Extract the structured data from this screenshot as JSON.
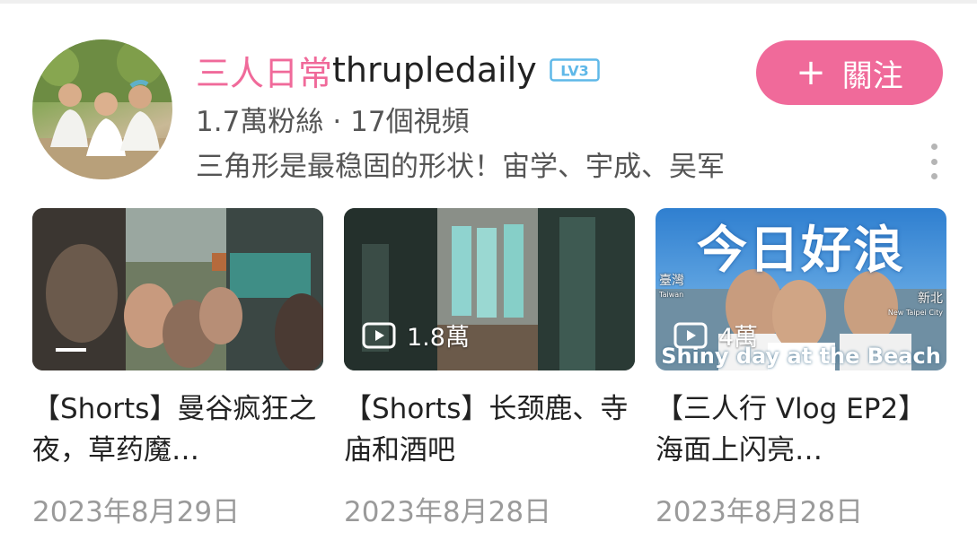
{
  "channel": {
    "name_cn": "三人日常",
    "name_en": "thrupledaily",
    "level": "LV3",
    "followers": "1.7萬粉絲",
    "separator": "·",
    "video_count": "17個視頻",
    "description": "三角形是最稳固的形状！宙学、宇成、吴军",
    "follow_label": "關注",
    "follow_icon": "plus-icon",
    "avatar_icon": "avatar",
    "more_icon": "more-vertical-icon"
  },
  "colors": {
    "accent": "#f06a9a",
    "level_badge": "#5fb8e8",
    "text": "#222222",
    "secondary": "#555555",
    "date": "#9a9a9a"
  },
  "videos": [
    {
      "title": "【Shorts】曼谷疯狂之夜，草药魔…",
      "views": "",
      "date": "2023年8月29日",
      "overlay_top": "",
      "overlay_bottom": ""
    },
    {
      "title": "【Shorts】长颈鹿、寺庙和酒吧",
      "views": "1.8萬",
      "date": "2023年8月28日",
      "overlay_top": "",
      "overlay_bottom": ""
    },
    {
      "title": "【三人行 Vlog EP2】海面上闪亮…",
      "views": "4萬",
      "date": "2023年8月28日",
      "overlay_top": "今日好浪",
      "overlay_bottom": "Shiny day at the Beach",
      "overlay_left": "臺灣",
      "overlay_left_sub": "Taiwan",
      "overlay_right": "新北",
      "overlay_right_sub": "New Taipei City"
    }
  ]
}
